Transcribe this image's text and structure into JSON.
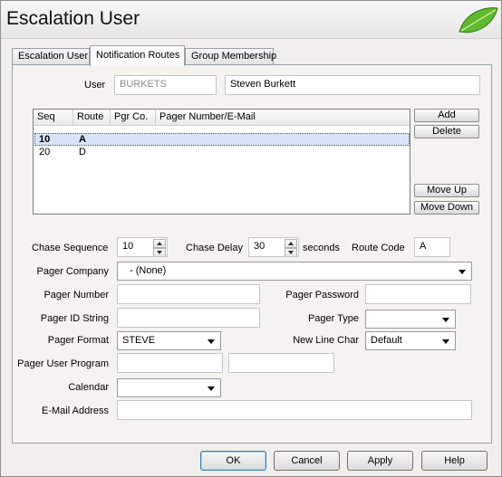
{
  "window": {
    "title": "Escalation User"
  },
  "tabs": [
    {
      "label": "Escalation User"
    },
    {
      "label": "Notification Routes"
    },
    {
      "label": "Group Membership"
    }
  ],
  "user": {
    "label": "User",
    "id_value": "BURKETS",
    "name_value": "Steven Burkett"
  },
  "routes_list": {
    "columns": [
      "Seq",
      "Route",
      "Pgr Co.",
      "Pager Number/E-Mail"
    ],
    "rows": [
      {
        "seq": "10",
        "route": "A",
        "pgr_co": "",
        "pager": "",
        "selected": true
      },
      {
        "seq": "20",
        "route": "D",
        "pgr_co": "",
        "pager": "",
        "selected": false
      }
    ]
  },
  "list_buttons": {
    "add": "Add",
    "delete": "Delete",
    "move_up": "Move Up",
    "move_down": "Move Down"
  },
  "form": {
    "chase_sequence_label": "Chase Sequence",
    "chase_sequence_value": "10",
    "chase_delay_label": "Chase Delay",
    "chase_delay_value": "30",
    "seconds_label": "seconds",
    "route_code_label": "Route Code",
    "route_code_value": "A",
    "pager_company_label": "Pager Company",
    "pager_company_value": "- (None)",
    "pager_number_label": "Pager Number",
    "pager_number_value": "",
    "pager_password_label": "Pager Password",
    "pager_password_value": "",
    "pager_id_label": "Pager ID String",
    "pager_id_value": "",
    "pager_type_label": "Pager Type",
    "pager_type_value": "",
    "pager_format_label": "Pager Format",
    "pager_format_value": "STEVE",
    "new_line_char_label": "New Line Char",
    "new_line_char_value": "Default",
    "pager_user_program_label": "Pager User Program",
    "pager_user_program_value": "",
    "pager_user_program_value2": "",
    "calendar_label": "Calendar",
    "calendar_value": "",
    "email_label": "E-Mail Address",
    "email_value": ""
  },
  "footer": {
    "ok": "OK",
    "cancel": "Cancel",
    "apply": "Apply",
    "help": "Help"
  },
  "colors": {
    "selected_row": "#d7e4f7",
    "window_bg": "#f0efeb"
  }
}
